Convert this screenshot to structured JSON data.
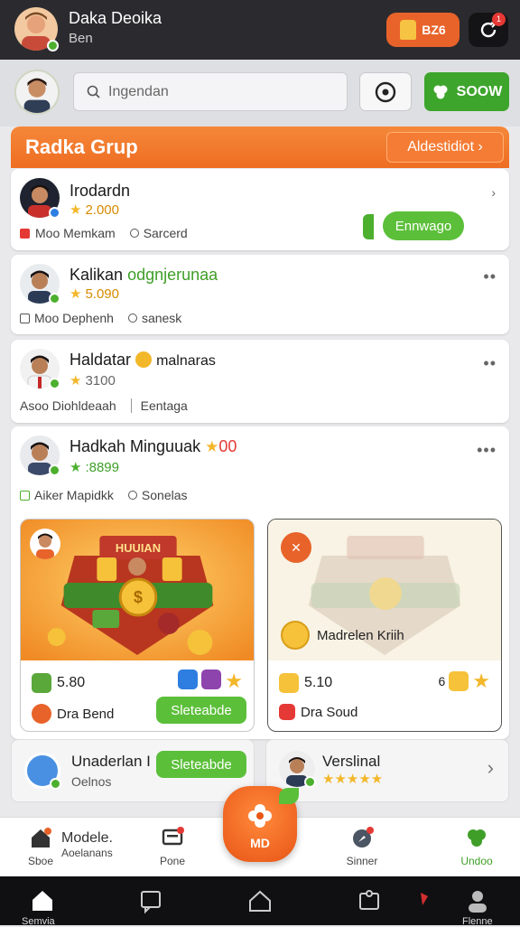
{
  "header": {
    "user_name": "Daka Deoika",
    "user_sub": "Ben",
    "coin_label": "BZ6",
    "notif_count": "1"
  },
  "search": {
    "placeholder": "Ingendan",
    "go_label": "SOOW"
  },
  "group": {
    "title": "Radka Grup",
    "link_label": "Aldestidiot ›"
  },
  "members": [
    {
      "name": "Irodardn",
      "score": "2.000",
      "meta1": "Moo Memkam",
      "meta2": "Sarcerd",
      "action": "Ennwago"
    },
    {
      "name": "Kalikan",
      "name_extra": "odgnjerunaa",
      "score": "5.090",
      "meta1": "Moo Dephenh",
      "meta2": "sanesk"
    },
    {
      "name": "Haldatar",
      "name_extra": "malnaras",
      "score": "3100",
      "meta1": "Asoo Diohldeaah",
      "meta2": "Eentaga"
    },
    {
      "name": "Hadkah Minguuak",
      "name_extra": "00",
      "score": ":8899",
      "meta1": "Aiker Mapidkk",
      "meta2": "Sonelas"
    }
  ],
  "promos": [
    {
      "banner": "HUUIAN",
      "value": "5.80",
      "sub": "Dra Bend",
      "button": "Sleteabde"
    },
    {
      "title": "Madrelen Kriih",
      "value": "5.10",
      "sub": "Dra Soud"
    }
  ],
  "minis": [
    {
      "title": "Unaderlan I",
      "sub": "Oelnos",
      "button": "Sleteabde"
    },
    {
      "title": "Verslinal"
    }
  ],
  "bottom_nav": {
    "item1": "Sboe",
    "item2_title": "Modele.",
    "item2_sub": "Aoelanans",
    "item3": "Pone",
    "center": "MD",
    "item5": "Sinner",
    "item6": "Undoo"
  },
  "system_nav": {
    "left_label": "Semvia",
    "right_label": "Flenne"
  },
  "colors": {
    "accent_orange": "#ee6d22",
    "green": "#3da52c",
    "dark_bar": "#2b2b2f"
  }
}
